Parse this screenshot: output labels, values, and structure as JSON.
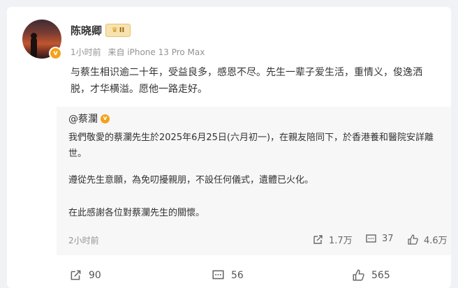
{
  "user": {
    "name": "陈晓卿",
    "verified_symbol": "v",
    "level_badge": "II"
  },
  "meta": {
    "time": "1小时前",
    "source": "来自 iPhone 13 Pro Max"
  },
  "post": {
    "text": "与蔡生相识逾二十年，受益良多，感恩不尽。先生一辈子爱生活，重情义，俊逸洒脱，才华横溢。愿他一路走好。"
  },
  "repost": {
    "author": "@蔡瀾",
    "verified_symbol": "v",
    "paragraphs": [
      "我們敬愛的蔡瀾先生於2025年6月25日(六月初一)，在親友陪同下，於香港養和醫院安詳離世。",
      "遵從先生意願，為免叨擾親朋，不設任何儀式，遺體已火化。",
      "在此感謝各位對蔡瀾先生的關懷。"
    ],
    "time": "2小时前",
    "stats": {
      "reposts": "1.7万",
      "comments": "37",
      "likes": "4.6万"
    }
  },
  "actions": {
    "reposts": "90",
    "comments": "56",
    "likes": "565"
  },
  "colors": {
    "page_bg": "#f1f2f5",
    "card_bg": "#ffffff",
    "repost_bg": "#f7f7f8",
    "verified": "#f4a21a",
    "muted": "#939393"
  }
}
